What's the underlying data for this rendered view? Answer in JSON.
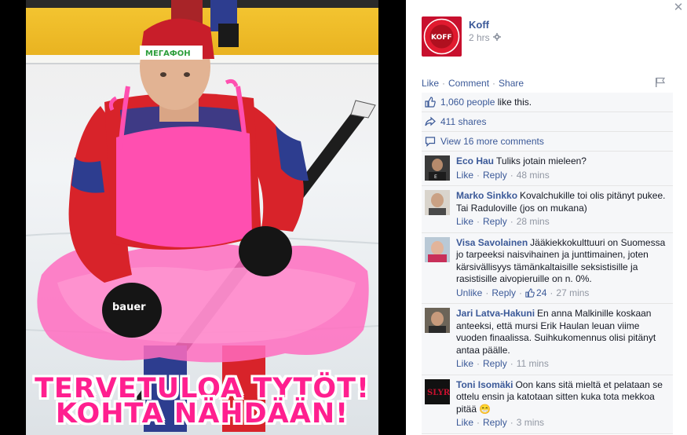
{
  "photo": {
    "caption_line1": "TERVETULOA TYTÖT!",
    "caption_line2": "KOHTA NÄHDÄÄN!",
    "helmet_sponsor": "МЕГАФОН",
    "jersey_colors": {
      "red": "#d8232a",
      "blue": "#2d3d8f",
      "pink": "#ff4fb0"
    }
  },
  "post": {
    "page_name": "Koff",
    "time": "2 hrs",
    "audience_icon": "gear-icon",
    "logo_text": "KOFF",
    "actions": [
      "Like",
      "Comment",
      "Share"
    ]
  },
  "ufi": {
    "likes_link": "1,060 people",
    "likes_suffix": "like this.",
    "shares": "411 shares",
    "view_more": "View 16 more comments"
  },
  "comments": [
    {
      "author": "Eco Hau",
      "text": "Tuliks jotain mieleen?",
      "actions": [
        "Like",
        "Reply"
      ],
      "time": "48 mins",
      "likes": ""
    },
    {
      "author": "Marko Sinkko",
      "text": "Kovalchukille toi olis pitänyt pukee. Tai Raduloville (jos on mukana)",
      "actions": [
        "Like",
        "Reply"
      ],
      "time": "28 mins",
      "likes": ""
    },
    {
      "author": "Visa Savolainen",
      "text": "Jääkiekkokulttuuri on Suomessa jo tarpeeksi naisvihainen ja junttimainen, joten kärsivällisyys tämänkaltaisille seksistisille ja rasistisille aivopieruille on n. 0%.",
      "actions": [
        "Unlike",
        "Reply"
      ],
      "time": "27 mins",
      "likes": "24"
    },
    {
      "author": "Jari Latva-Hakuni",
      "text": "En anna Malkinille koskaan anteeksi, että mursi Erik Haulan leuan viime vuoden finaalissa. Suihkukomennus olisi pitänyt antaa päälle.",
      "actions": [
        "Like",
        "Reply"
      ],
      "time": "11 mins",
      "likes": ""
    },
    {
      "author": "Toni Isomäki",
      "text": "Oon kans sitä mieltä et pelataan se ottelu ensin ja katotaan sitten kuka tota mekkoa pitää",
      "actions": [
        "Like",
        "Reply"
      ],
      "time": "3 mins",
      "likes": "",
      "emoji": "😁"
    }
  ],
  "colors": {
    "link": "#3b5998",
    "meta": "#9197a3",
    "panel_bg": "#f6f7f9",
    "caption": "#ff1f8f"
  }
}
